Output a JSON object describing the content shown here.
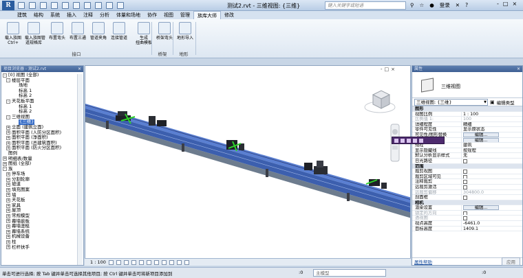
{
  "app": {
    "title": "测试2.rvt - 三维视图: {三维}",
    "search_placeholder": "键入关键字或短语",
    "login": "登录",
    "help": "?",
    "window_controls": [
      "-",
      "□",
      "×"
    ]
  },
  "menu_tabs": [
    "建筑",
    "结构",
    "系统",
    "插入",
    "注释",
    "分析",
    "体量和场地",
    "协作",
    "视图",
    "管理",
    "族库大师",
    "修改"
  ],
  "active_tab_index": 10,
  "ribbon": {
    "buttons": [
      {
        "label": "载入族图\nCtrl+"
      },
      {
        "label": "载入族图管\n道规格库"
      },
      {
        "label": "布置弯头"
      },
      {
        "label": "布置三通"
      },
      {
        "label": "管道夹角"
      },
      {
        "label": "连接管道"
      },
      {
        "label": "生成\n扭曲模板"
      },
      {
        "label": "桥架弯头"
      },
      {
        "label": "地形导入"
      }
    ],
    "groups": [
      "接口",
      "桥架",
      "地形"
    ]
  },
  "browser": {
    "title": "项目浏览器 - 测试2.rvt",
    "items": [
      {
        "text": "[0] 视图 (全部)",
        "indent": 0,
        "toggle": "-"
      },
      {
        "text": "楼层平面",
        "indent": 1,
        "toggle": "-"
      },
      {
        "text": "场地",
        "indent": 3
      },
      {
        "text": "标高 1",
        "indent": 3
      },
      {
        "text": "标高 2",
        "indent": 3
      },
      {
        "text": "天花板平面",
        "indent": 1,
        "toggle": "-"
      },
      {
        "text": "标高 1",
        "indent": 3
      },
      {
        "text": "标高 2",
        "indent": 3
      },
      {
        "text": "三维视图",
        "indent": 1,
        "toggle": "-"
      },
      {
        "text": "{三维}",
        "indent": 3,
        "selected": true
      },
      {
        "text": "立面 (建筑立面)",
        "indent": 1,
        "toggle": "+"
      },
      {
        "text": "面积平面 (人防分区面积)",
        "indent": 1,
        "toggle": "+"
      },
      {
        "text": "面积平面 (净面积)",
        "indent": 1,
        "toggle": "+"
      },
      {
        "text": "面积平面 (总建筑面积)",
        "indent": 1,
        "toggle": "+"
      },
      {
        "text": "面积平面 (防火分区面积)",
        "indent": 1,
        "toggle": "+"
      },
      {
        "text": "图例",
        "indent": 0
      },
      {
        "text": "明细表/数量",
        "indent": 0,
        "toggle": "+"
      },
      {
        "text": "图纸 (全部)",
        "indent": 0,
        "toggle": "+"
      },
      {
        "text": "族",
        "indent": 0,
        "toggle": "-"
      },
      {
        "text": "停车场",
        "indent": 1,
        "toggle": "+"
      },
      {
        "text": "分割轮廓",
        "indent": 1,
        "toggle": "+"
      },
      {
        "text": "坡道",
        "indent": 1,
        "toggle": "+"
      },
      {
        "text": "填充图案",
        "indent": 1,
        "toggle": "+"
      },
      {
        "text": "墙",
        "indent": 1,
        "toggle": "+"
      },
      {
        "text": "天花板",
        "indent": 1,
        "toggle": "+"
      },
      {
        "text": "家具",
        "indent": 1,
        "toggle": "+"
      },
      {
        "text": "屋顶",
        "indent": 1,
        "toggle": "+"
      },
      {
        "text": "常规模型",
        "indent": 1,
        "toggle": "+"
      },
      {
        "text": "幕墙嵌板",
        "indent": 1,
        "toggle": "+"
      },
      {
        "text": "幕墙竖梃",
        "indent": 1,
        "toggle": "+"
      },
      {
        "text": "幕墙系统",
        "indent": 1,
        "toggle": "+"
      },
      {
        "text": "机械设备",
        "indent": 1,
        "toggle": "+"
      },
      {
        "text": "柱",
        "indent": 1,
        "toggle": "+"
      },
      {
        "text": "栏杆扶手",
        "indent": 1,
        "toggle": "+"
      }
    ]
  },
  "properties": {
    "title": "属性",
    "type_name": "三维视图",
    "type_selector": "三维视图: {三维}",
    "edit_type": "编辑类型",
    "rows": [
      {
        "group": "图形"
      },
      {
        "k": "视图比例",
        "v": "1 : 100"
      },
      {
        "k": "比例值 1:",
        "v": "100",
        "grey": true
      },
      {
        "k": "详细程度",
        "v": "精细"
      },
      {
        "k": "零件可见性",
        "v": "显示原状态"
      },
      {
        "k": "可见性/图形替换",
        "btn": "编辑..."
      },
      {
        "k": "图形显示选项",
        "btn": "编辑..."
      },
      {
        "k": "规程",
        "v": "建筑"
      },
      {
        "k": "显示隐藏线",
        "v": "按规程"
      },
      {
        "k": "默认分析显示样式",
        "v": "无"
      },
      {
        "k": "日光路径",
        "check": true
      },
      {
        "group": "范围"
      },
      {
        "k": "裁剪视图",
        "check": true
      },
      {
        "k": "裁剪区域可见",
        "check": true
      },
      {
        "k": "注释裁剪",
        "check": true
      },
      {
        "k": "远裁剪激活",
        "check": true
      },
      {
        "k": "远裁剪偏移",
        "v": "304800.0",
        "grey": true
      },
      {
        "k": "剖面框",
        "check": true
      },
      {
        "group": "相机"
      },
      {
        "k": "渲染设置",
        "btn": "编辑..."
      },
      {
        "k": "锁定的方向",
        "check": true,
        "grey": true
      },
      {
        "k": "透视图",
        "check": true,
        "grey": true
      },
      {
        "k": "视点高度",
        "v": "-6461.0"
      },
      {
        "k": "目标高度",
        "v": "1409.1"
      }
    ],
    "help_link": "属性帮助",
    "apply": "应用"
  },
  "viewport": {
    "scale": "1 : 100",
    "controls": [
      "-",
      "□",
      "×"
    ]
  },
  "status": {
    "text": "单击可进行选择; 按 Tab 键并单击可选择其他项目; 按 Ctrl 键并单击可将新项目添加到",
    "z": ":0",
    "model": "主模型",
    "filter": ":0"
  },
  "colors": {
    "pipe_top": "#5a7fd1",
    "pipe_side": "#6d7c8e",
    "fitting": "#1e2026",
    "highlight_green": "#2fd12a",
    "float_toolbar": "#4d2b6e"
  }
}
